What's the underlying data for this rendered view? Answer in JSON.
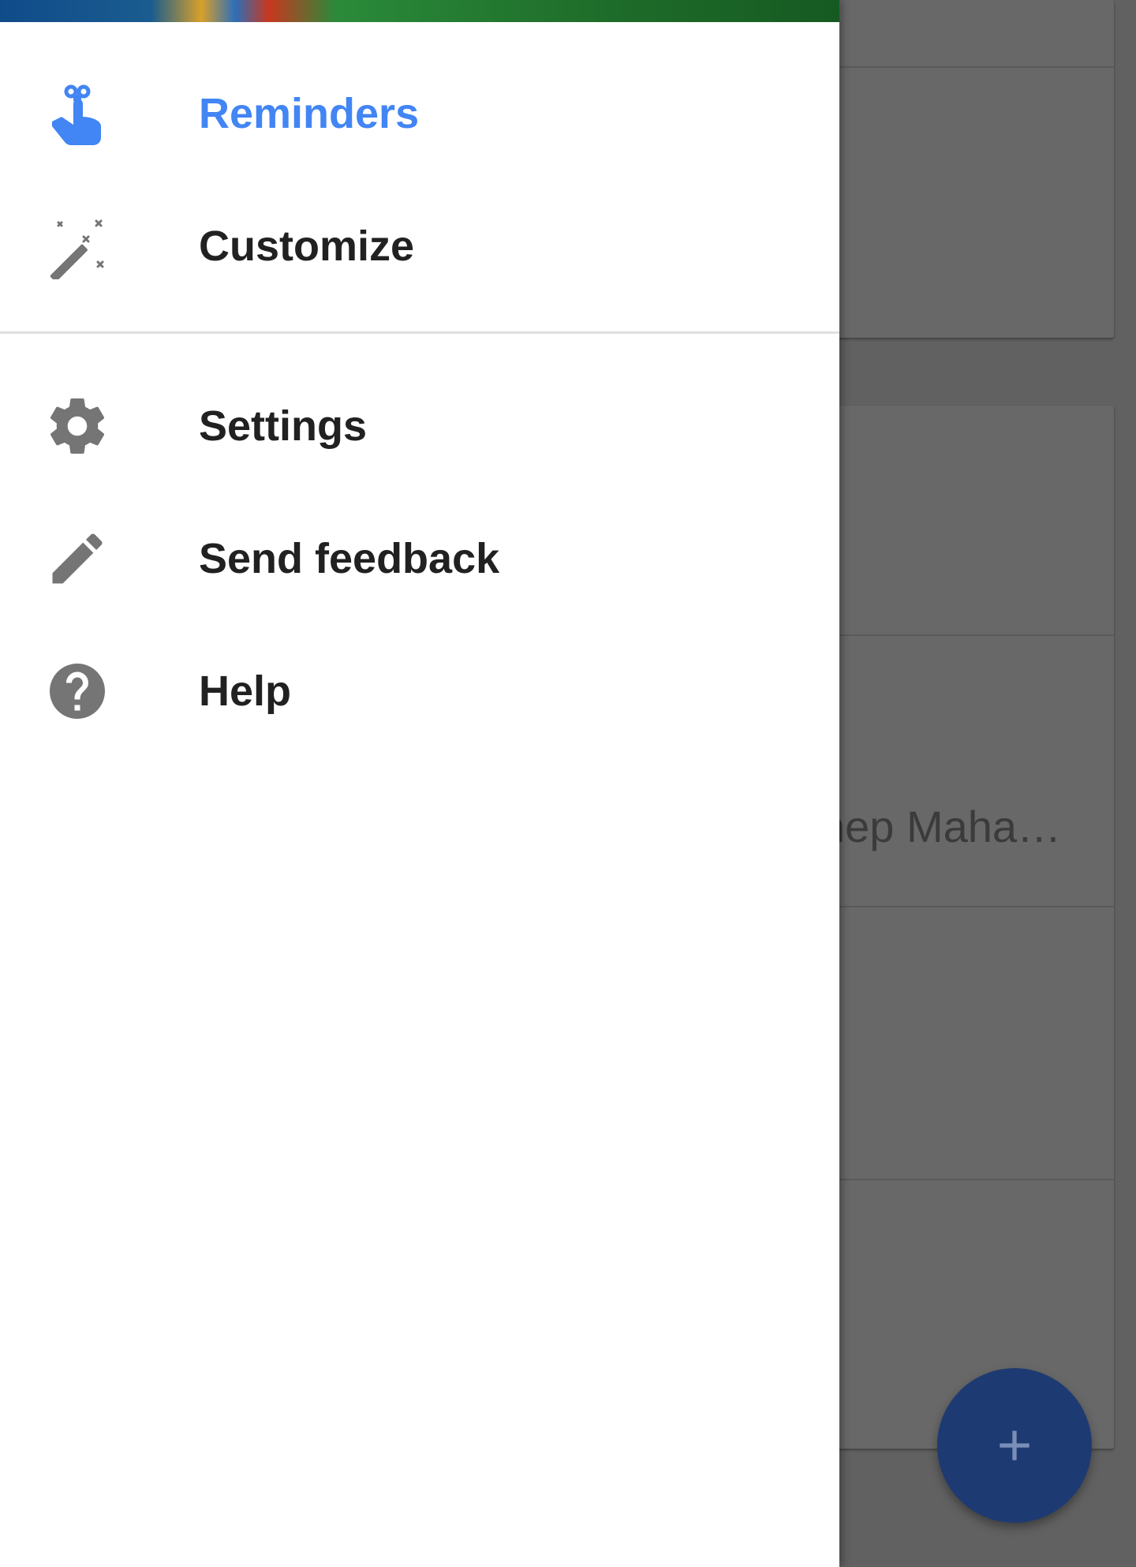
{
  "drawer": {
    "items": [
      {
        "label": "Reminders",
        "icon": "reminder-finger-icon",
        "active": true
      },
      {
        "label": "Customize",
        "icon": "magic-wand-icon",
        "active": false
      },
      {
        "label": "Settings",
        "icon": "gear-icon",
        "active": false
      },
      {
        "label": "Send feedback",
        "icon": "pencil-icon",
        "active": false
      },
      {
        "label": "Help",
        "icon": "help-circle-icon",
        "active": false
      }
    ]
  },
  "background": {
    "snippet_text": "hep Maha…",
    "fab_icon": "plus-icon"
  },
  "colors": {
    "accent": "#4285f4",
    "icon_gray": "#757575",
    "fab": "#1e3a72",
    "scrim_bg": "#616161"
  }
}
